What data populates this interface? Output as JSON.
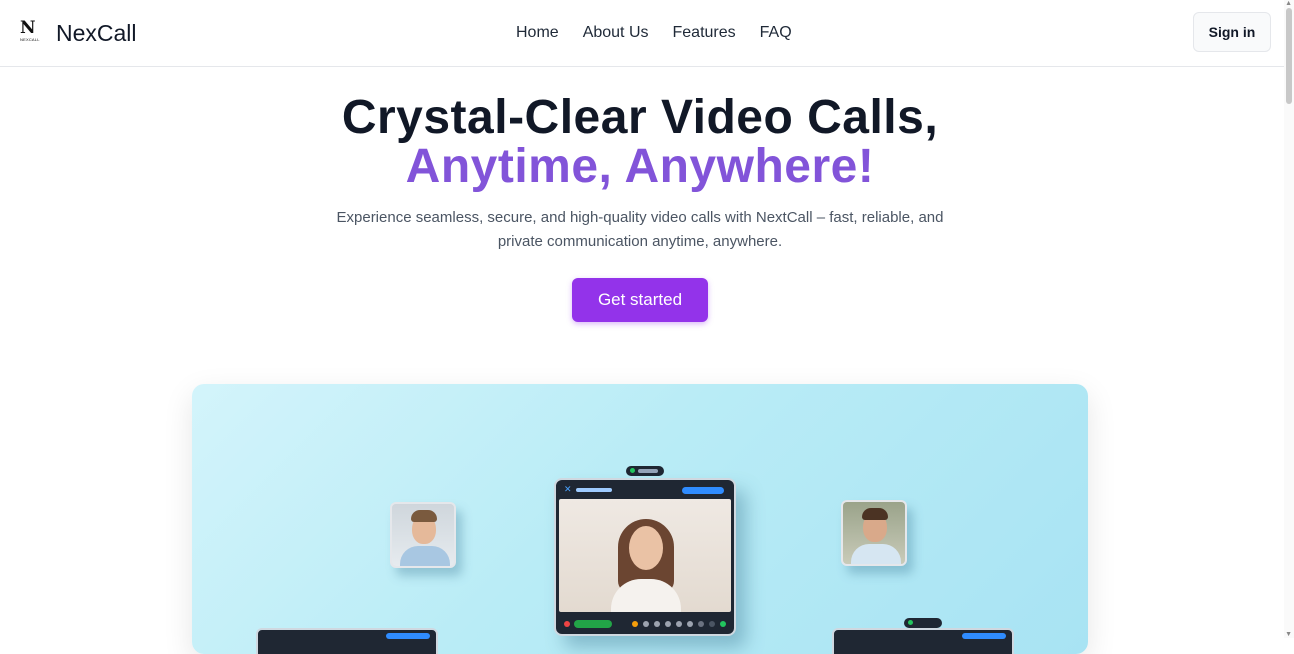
{
  "brand": {
    "logo_mark": "N",
    "logo_sub": "NEXCALL",
    "name": "NexCall"
  },
  "nav": {
    "items": [
      "Home",
      "About Us",
      "Features",
      "FAQ"
    ]
  },
  "header": {
    "signin_label": "Sign in"
  },
  "hero": {
    "title_line1": "Crystal-Clear Video Calls,",
    "title_line2": "Anytime, Anywhere!",
    "subtitle": "Experience seamless, secure, and high-quality video calls with NextCall – fast, reliable, and private communication anytime, anywhere.",
    "cta_label": "Get started"
  },
  "colors": {
    "accent_purple": "#9333ea",
    "headline_purple": "#8254d9",
    "illustration_bg": "#b9ecf6"
  }
}
